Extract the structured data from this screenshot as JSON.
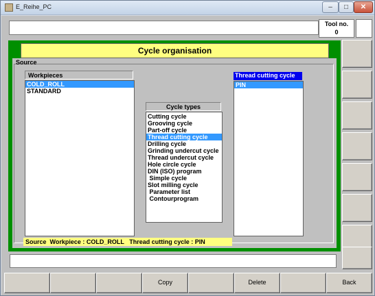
{
  "window": {
    "title": "E_Reihe_PC"
  },
  "tool": {
    "label": "Tool no.",
    "value": "0"
  },
  "header": {
    "title": "Cycle organisation"
  },
  "source": {
    "label": "Source"
  },
  "workpieces": {
    "header": "Workpieces",
    "items": [
      {
        "label": "COLD_ROLL",
        "selected": true
      },
      {
        "label": "STANDARD",
        "selected": false
      }
    ]
  },
  "cycle_types": {
    "header": "Cycle types",
    "items": [
      {
        "label": "Cutting cycle",
        "selected": false
      },
      {
        "label": "Grooving cycle",
        "selected": false
      },
      {
        "label": "Part-off cycle",
        "selected": false
      },
      {
        "label": "Thread cutting cycle",
        "selected": true
      },
      {
        "label": "Drilling cycle",
        "selected": false
      },
      {
        "label": "Grinding undercut cycle",
        "selected": false
      },
      {
        "label": "Thread undercut cycle",
        "selected": false
      },
      {
        "label": "Hole circle cycle",
        "selected": false
      },
      {
        "label": "DIN (ISO) program",
        "selected": false
      },
      {
        "label": " Simple cycle",
        "selected": false
      },
      {
        "label": "Slot milling cycle",
        "selected": false
      },
      {
        "label": " Parameter list",
        "selected": false
      },
      {
        "label": " Contourprogram",
        "selected": false
      }
    ]
  },
  "thread_list": {
    "header": "Thread cutting cycle",
    "items": [
      {
        "label": "PIN",
        "selected": true
      }
    ]
  },
  "status": {
    "text": "Source  Workpiece : COLD_ROLL   Thread cutting cycle : PIN"
  },
  "bottom_buttons": [
    "",
    "",
    "",
    "Copy",
    "",
    "Delete",
    "",
    "Back"
  ],
  "colors": {
    "green_frame": "#008f00",
    "highlight": "#3399ff",
    "header_yellow": "#ffff80",
    "thread_header_blue": "#0000ee"
  }
}
